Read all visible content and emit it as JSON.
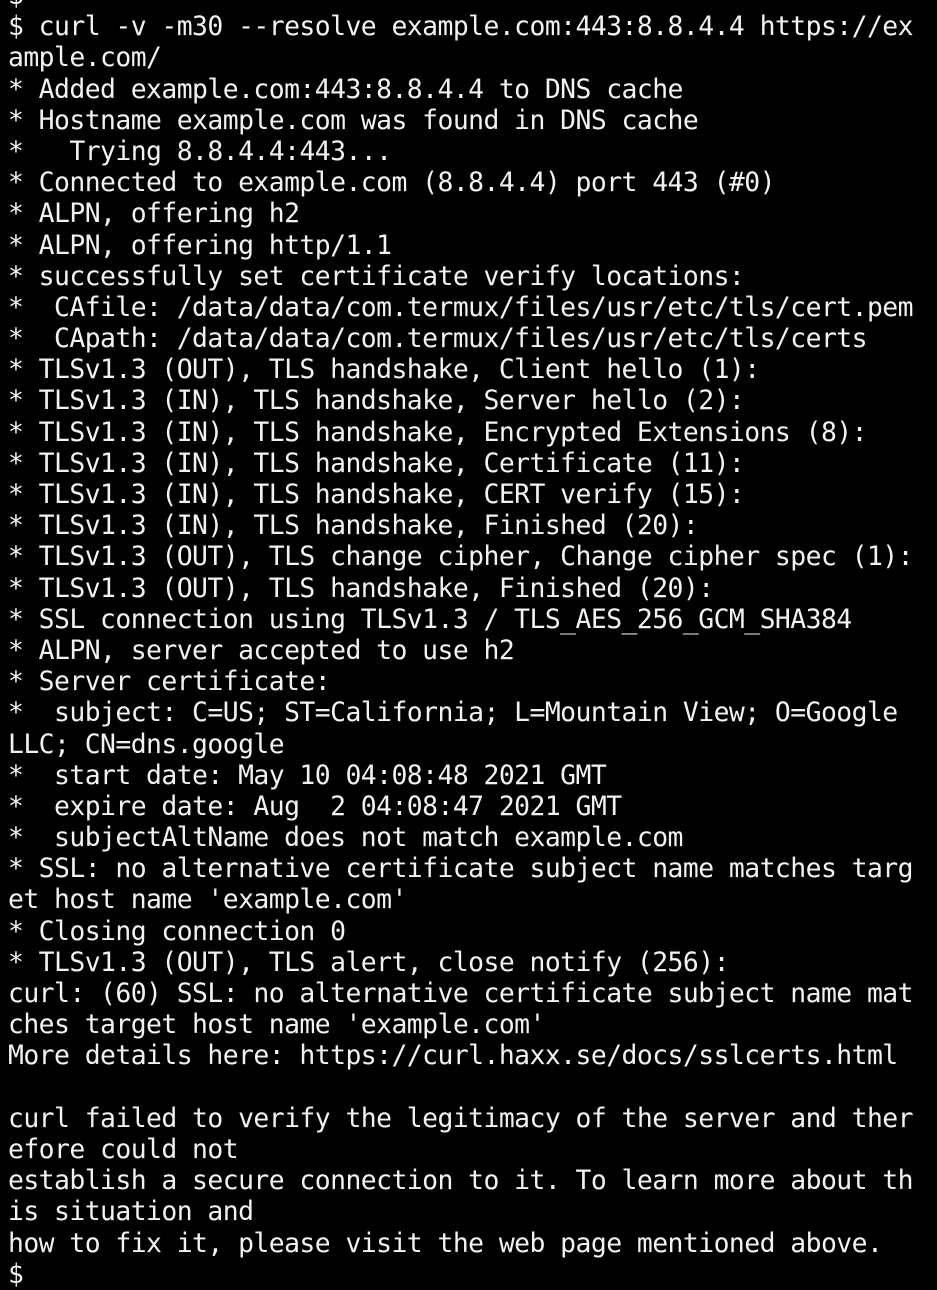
{
  "terminal": {
    "lines": [
      "$",
      "$ curl -v -m30 --resolve example.com:443:8.8.4.4 https://ex",
      "ample.com/",
      "* Added example.com:443:8.8.4.4 to DNS cache",
      "* Hostname example.com was found in DNS cache",
      "*   Trying 8.8.4.4:443...",
      "* Connected to example.com (8.8.4.4) port 443 (#0)",
      "* ALPN, offering h2",
      "* ALPN, offering http/1.1",
      "* successfully set certificate verify locations:",
      "*  CAfile: /data/data/com.termux/files/usr/etc/tls/cert.pem",
      "*  CApath: /data/data/com.termux/files/usr/etc/tls/certs",
      "* TLSv1.3 (OUT), TLS handshake, Client hello (1):",
      "* TLSv1.3 (IN), TLS handshake, Server hello (2):",
      "* TLSv1.3 (IN), TLS handshake, Encrypted Extensions (8):",
      "* TLSv1.3 (IN), TLS handshake, Certificate (11):",
      "* TLSv1.3 (IN), TLS handshake, CERT verify (15):",
      "* TLSv1.3 (IN), TLS handshake, Finished (20):",
      "* TLSv1.3 (OUT), TLS change cipher, Change cipher spec (1):",
      "* TLSv1.3 (OUT), TLS handshake, Finished (20):",
      "* SSL connection using TLSv1.3 / TLS_AES_256_GCM_SHA384",
      "* ALPN, server accepted to use h2",
      "* Server certificate:",
      "*  subject: C=US; ST=California; L=Mountain View; O=Google",
      "LLC; CN=dns.google",
      "*  start date: May 10 04:08:48 2021 GMT",
      "*  expire date: Aug  2 04:08:47 2021 GMT",
      "*  subjectAltName does not match example.com",
      "* SSL: no alternative certificate subject name matches targ",
      "et host name 'example.com'",
      "* Closing connection 0",
      "* TLSv1.3 (OUT), TLS alert, close notify (256):",
      "curl: (60) SSL: no alternative certificate subject name mat",
      "ches target host name 'example.com'",
      "More details here: https://curl.haxx.se/docs/sslcerts.html",
      "",
      "curl failed to verify the legitimacy of the server and ther",
      "efore could not",
      "establish a secure connection to it. To learn more about th",
      "is situation and",
      "how to fix it, please visit the web page mentioned above.",
      "$"
    ]
  }
}
